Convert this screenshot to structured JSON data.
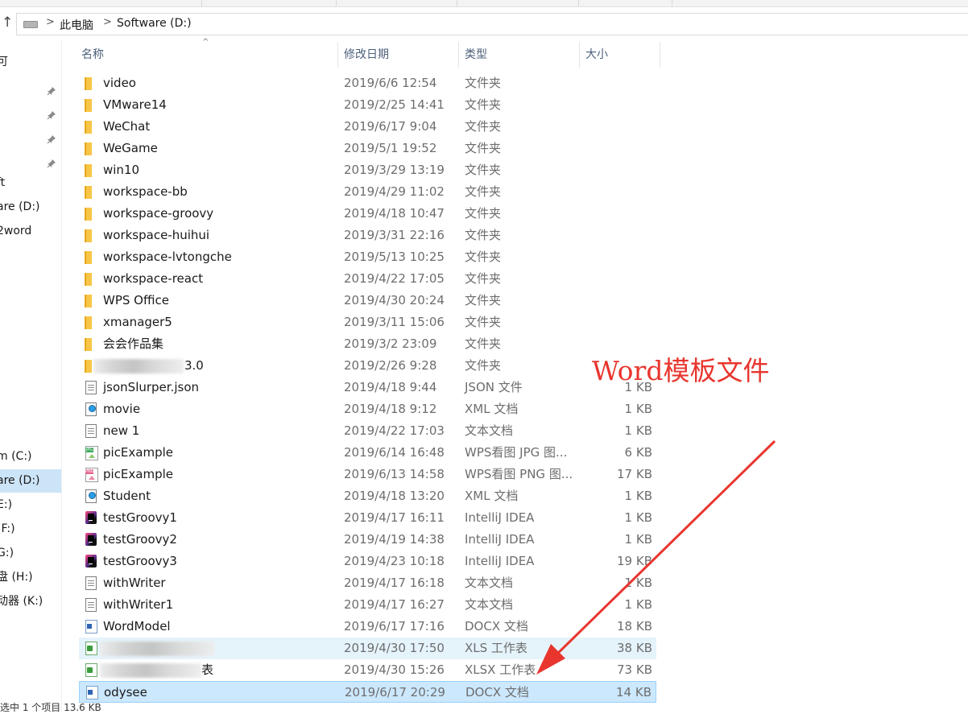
{
  "address": {
    "up_icon": "up-arrow-icon",
    "crumbs": [
      "此电脑",
      "Software (D:)"
    ]
  },
  "columns": {
    "name": "名称",
    "date": "修改日期",
    "type": "类型",
    "size": "大小"
  },
  "sidebar": {
    "items": [
      {
        "label": "可",
        "pinned": false
      },
      {
        "label": "",
        "pinned": true
      },
      {
        "label": "",
        "pinned": true
      },
      {
        "label": "",
        "pinned": true
      },
      {
        "label": "",
        "pinned": true
      },
      {
        "label": "ft",
        "pinned": false
      },
      {
        "label": "are (D:)",
        "pinned": false
      },
      {
        "label": "2word",
        "pinned": false
      },
      {
        "label": "m (C:)",
        "pinned": false
      },
      {
        "label": "are (D:)",
        "pinned": false,
        "selected": true
      },
      {
        "label": "E:)",
        "pinned": false
      },
      {
        "label": "(F:)",
        "pinned": false
      },
      {
        "label": "G:)",
        "pinned": false
      },
      {
        "label": "盘 (H:)",
        "pinned": false
      },
      {
        "label": "动器 (K:)",
        "pinned": false
      }
    ]
  },
  "files": [
    {
      "name": "video",
      "date": "2019/6/6 12:54",
      "type": "文件夹",
      "size": "",
      "icon": "folder"
    },
    {
      "name": "VMware14",
      "date": "2019/2/25 14:41",
      "type": "文件夹",
      "size": "",
      "icon": "folder"
    },
    {
      "name": "WeChat",
      "date": "2019/6/17 9:04",
      "type": "文件夹",
      "size": "",
      "icon": "folder"
    },
    {
      "name": "WeGame",
      "date": "2019/5/1 19:52",
      "type": "文件夹",
      "size": "",
      "icon": "folder"
    },
    {
      "name": "win10",
      "date": "2019/3/29 13:19",
      "type": "文件夹",
      "size": "",
      "icon": "folder"
    },
    {
      "name": "workspace-bb",
      "date": "2019/4/29 11:02",
      "type": "文件夹",
      "size": "",
      "icon": "folder"
    },
    {
      "name": "workspace-groovy",
      "date": "2019/4/18 10:47",
      "type": "文件夹",
      "size": "",
      "icon": "folder"
    },
    {
      "name": "workspace-huihui",
      "date": "2019/3/31 22:16",
      "type": "文件夹",
      "size": "",
      "icon": "folder"
    },
    {
      "name": "workspace-lvtongche",
      "date": "2019/5/13 10:25",
      "type": "文件夹",
      "size": "",
      "icon": "folder"
    },
    {
      "name": "workspace-react",
      "date": "2019/4/22 17:05",
      "type": "文件夹",
      "size": "",
      "icon": "folder"
    },
    {
      "name": "WPS Office",
      "date": "2019/4/30 20:24",
      "type": "文件夹",
      "size": "",
      "icon": "folder"
    },
    {
      "name": "xmanager5",
      "date": "2019/3/11 15:06",
      "type": "文件夹",
      "size": "",
      "icon": "folder"
    },
    {
      "name": "会会作品集",
      "date": "2019/3/2 23:09",
      "type": "文件夹",
      "size": "",
      "icon": "folder"
    },
    {
      "name": "3.0",
      "date": "2019/2/26 9:28",
      "type": "文件夹",
      "size": "",
      "icon": "folder",
      "blurred": true
    },
    {
      "name": "jsonSlurper.json",
      "date": "2019/4/18 9:44",
      "type": "JSON 文件",
      "size": "1 KB",
      "icon": "doc"
    },
    {
      "name": "movie",
      "date": "2019/4/18 9:12",
      "type": "XML 文档",
      "size": "1 KB",
      "icon": "xml"
    },
    {
      "name": "new 1",
      "date": "2019/4/22 17:03",
      "type": "文本文档",
      "size": "1 KB",
      "icon": "doc"
    },
    {
      "name": "picExample",
      "date": "2019/6/14 16:48",
      "type": "WPS看图 JPG 图...",
      "size": "6 KB",
      "icon": "jpg"
    },
    {
      "name": "picExample",
      "date": "2019/6/13 14:58",
      "type": "WPS看图 PNG 图...",
      "size": "17 KB",
      "icon": "png"
    },
    {
      "name": "Student",
      "date": "2019/4/18 13:20",
      "type": "XML 文档",
      "size": "1 KB",
      "icon": "xml"
    },
    {
      "name": "testGroovy1",
      "date": "2019/4/17 16:11",
      "type": "IntelliJ IDEA",
      "size": "1 KB",
      "icon": "intellij"
    },
    {
      "name": "testGroovy2",
      "date": "2019/4/19 14:38",
      "type": "IntelliJ IDEA",
      "size": "1 KB",
      "icon": "intellij"
    },
    {
      "name": "testGroovy3",
      "date": "2019/4/23 10:18",
      "type": "IntelliJ IDEA",
      "size": "19 KB",
      "icon": "intellij"
    },
    {
      "name": "withWriter",
      "date": "2019/4/17 16:18",
      "type": "文本文档",
      "size": "1 KB",
      "icon": "doc"
    },
    {
      "name": "withWriter1",
      "date": "2019/4/17 16:27",
      "type": "文本文档",
      "size": "1 KB",
      "icon": "doc"
    },
    {
      "name": "WordModel",
      "date": "2019/6/17 17:16",
      "type": "DOCX 文档",
      "size": "18 KB",
      "icon": "docx"
    },
    {
      "name": "",
      "date": "2019/4/30 17:50",
      "type": "XLS 工作表",
      "size": "38 KB",
      "icon": "xls",
      "blurred": true,
      "state": "hover"
    },
    {
      "name": "表",
      "date": "2019/4/30 15:26",
      "type": "XLSX 工作表",
      "size": "73 KB",
      "icon": "xls",
      "blurred": true
    },
    {
      "name": "odysee",
      "date": "2019/6/17 20:29",
      "type": "DOCX 文档",
      "size": "14 KB",
      "icon": "docx",
      "state": "selected"
    }
  ],
  "annotation": {
    "text": "Word模板文件",
    "color": "#e8362f"
  },
  "status": {
    "text": "选中 1 个项目  13.6 KB"
  },
  "colors": {
    "selection_bg": "#cce8ff",
    "selection_border": "#99d1ff",
    "hover_bg": "#e5f3fb",
    "header_text": "#4c607a",
    "folder": "#f8c546"
  }
}
